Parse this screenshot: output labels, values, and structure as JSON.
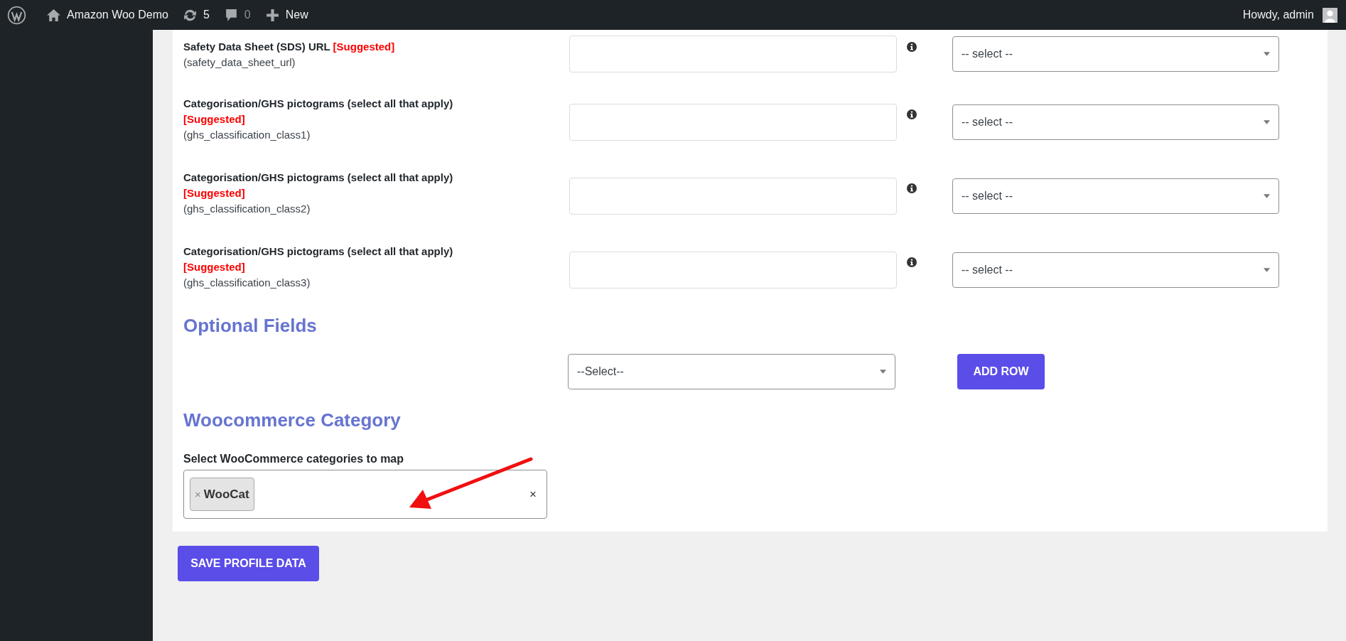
{
  "admin_bar": {
    "site_name": "Amazon Woo Demo",
    "updates_count": "5",
    "comments_count": "0",
    "new_label": "New",
    "greeting": "Howdy, admin"
  },
  "fields": [
    {
      "label": "Safety Data Sheet (SDS) URL",
      "tag": "[Suggested]",
      "key": "(safety_data_sheet_url)",
      "select": "-- select --"
    },
    {
      "label": "Categorisation/GHS pictograms (select all that apply)",
      "tag": "[Suggested]",
      "key": "(ghs_classification_class1)",
      "select": "-- select --"
    },
    {
      "label": "Categorisation/GHS pictograms (select all that apply)",
      "tag": "[Suggested]",
      "key": "(ghs_classification_class2)",
      "select": "-- select --"
    },
    {
      "label": "Categorisation/GHS pictograms (select all that apply)",
      "tag": "[Suggested]",
      "key": "(ghs_classification_class3)",
      "select": "-- select --"
    }
  ],
  "optional_fields": {
    "heading": "Optional Fields",
    "select": "--Select--",
    "button": "ADD ROW"
  },
  "woocommerce_category": {
    "heading": "Woocommerce Category",
    "label": "Select WooCommerce categories to map",
    "tags": [
      {
        "remove": "×",
        "label": "WooCat"
      }
    ],
    "clear": "×"
  },
  "save_button": "SAVE PROFILE DATA"
}
